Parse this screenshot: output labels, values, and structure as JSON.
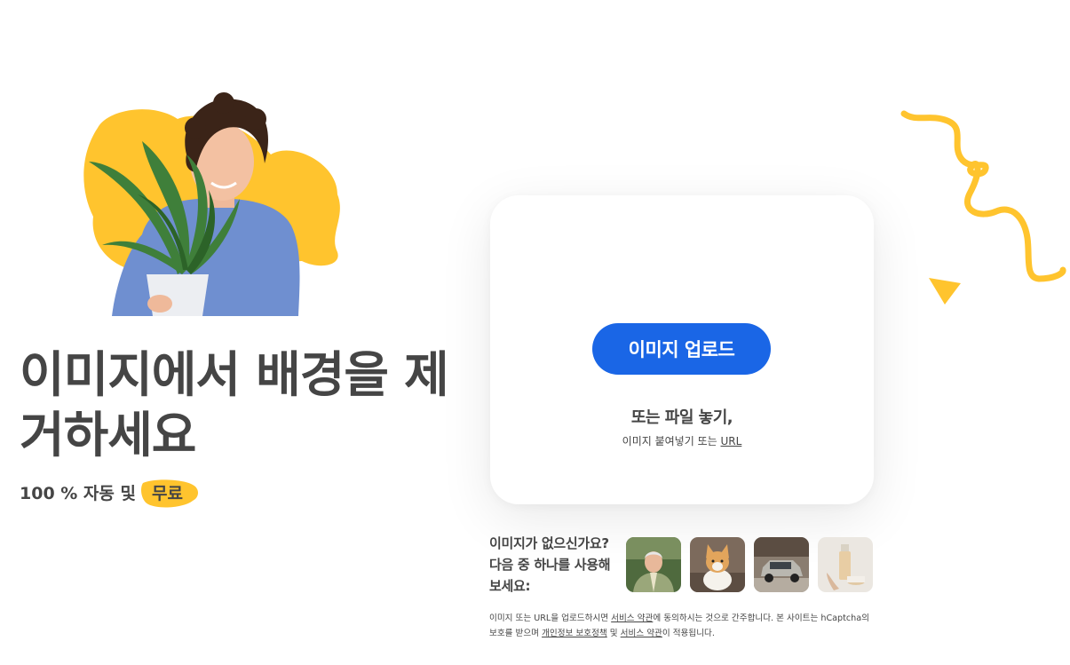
{
  "headline": "이미지에서 배경을 제거하세요",
  "subline": {
    "prefix": "100 % 자동 및",
    "highlight": "무료"
  },
  "upload_card": {
    "upload_button": "이미지 업로드",
    "drop_text": "또는 파일 놓기,",
    "paste_text": "이미지 붙여넣기 또는",
    "url_link": "URL"
  },
  "samples": {
    "prompt": "이미지가 없으신가요? 다음 중 하나를 사용해 보세요:",
    "items": [
      {
        "icon": "man-portrait-thumbnail"
      },
      {
        "icon": "corgi-dog-thumbnail"
      },
      {
        "icon": "car-thumbnail"
      },
      {
        "icon": "cosmetics-bottle-thumbnail"
      }
    ]
  },
  "terms": {
    "part1": "이미지 또는 URL을 업로드하시면 ",
    "link_terms": "서비스 약관",
    "part2": "에 동의하시는 것으로 간주합니다. 본 사이트는 hCaptcha의 보호를 받으며 ",
    "link_privacy": "개인정보 보호정책",
    "part3": " 및 ",
    "link_terms2": "서비스 약관",
    "part4": "이 적용됩니다."
  },
  "colors": {
    "accent_blue": "#1a66e6",
    "brand_yellow": "#ffc42e",
    "text": "#454545"
  }
}
